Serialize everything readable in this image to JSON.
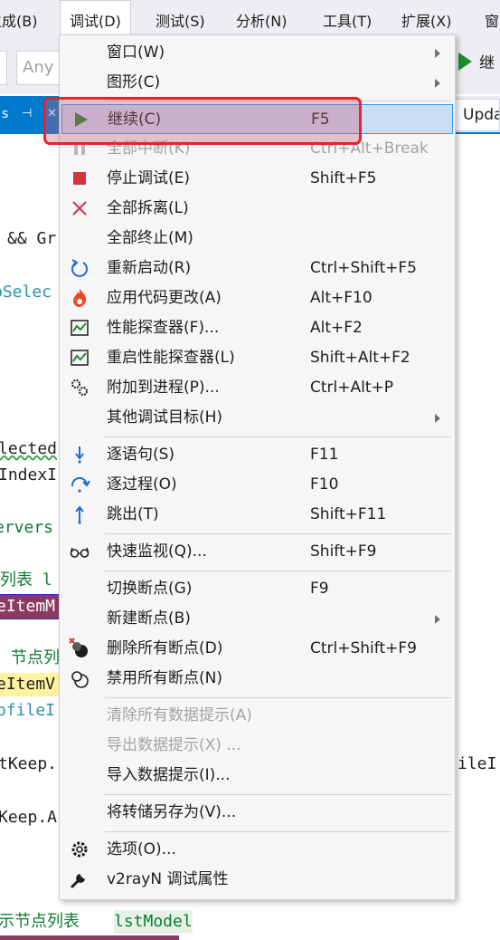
{
  "menubar": {
    "items": [
      "生成(B)",
      "调试(D)",
      "测试(S)",
      "分析(N)",
      "工具(T)",
      "扩展(X)",
      "窗"
    ]
  },
  "toolbar": {
    "config_combo": "Any",
    "continue_label": "继"
  },
  "tabs": {
    "active_tab": "s",
    "pin_glyph": "⊣",
    "close_glyph": "✕",
    "right_tab": "Upda"
  },
  "code": {
    "l1": "&& Gr",
    "l2": "bSelec",
    "l3": "lected",
    "l4": "IndexI",
    "l5": "ervers",
    "l6": "列表 l",
    "l7": "eItemM",
    "l8": "节点列",
    "l9": "eItemV",
    "l10": "ofileI",
    "l11": "tKeep.",
    "l11r": "ileI",
    "l12": "Keep.A",
    "l13a": "示节点列表 ",
    "l13b": "lstModel"
  },
  "menu": {
    "items": [
      {
        "id": "window",
        "label": "窗口(W)",
        "shortcut": "",
        "submenu": true,
        "disabled": false,
        "icon": ""
      },
      {
        "id": "graphics",
        "label": "图形(C)",
        "shortcut": "",
        "submenu": true,
        "disabled": false,
        "icon": ""
      },
      {
        "id": "continue",
        "label": "继续(C)",
        "shortcut": "F5",
        "submenu": false,
        "disabled": false,
        "icon": "play-icon"
      },
      {
        "id": "break-all",
        "label": "全部中断(K)",
        "shortcut": "Ctrl+Alt+Break",
        "submenu": false,
        "disabled": true,
        "icon": "pause-icon"
      },
      {
        "id": "stop",
        "label": "停止调试(E)",
        "shortcut": "Shift+F5",
        "submenu": false,
        "disabled": false,
        "icon": "stop-icon"
      },
      {
        "id": "detach-all",
        "label": "全部拆离(L)",
        "shortcut": "",
        "submenu": false,
        "disabled": false,
        "icon": "detach-icon"
      },
      {
        "id": "terminate-all",
        "label": "全部终止(M)",
        "shortcut": "",
        "submenu": false,
        "disabled": false,
        "icon": ""
      },
      {
        "id": "restart",
        "label": "重新启动(R)",
        "shortcut": "Ctrl+Shift+F5",
        "submenu": false,
        "disabled": false,
        "icon": "restart-icon"
      },
      {
        "id": "apply-code",
        "label": "应用代码更改(A)",
        "shortcut": "Alt+F10",
        "submenu": false,
        "disabled": false,
        "icon": "hot-reload-icon"
      },
      {
        "id": "profiler",
        "label": "性能探查器(F)...",
        "shortcut": "Alt+F2",
        "submenu": false,
        "disabled": false,
        "icon": "profiler-icon"
      },
      {
        "id": "relaunch-profiler",
        "label": "重启性能探查器(L)",
        "shortcut": "Shift+Alt+F2",
        "submenu": false,
        "disabled": false,
        "icon": "profiler-icon"
      },
      {
        "id": "attach",
        "label": "附加到进程(P)...",
        "shortcut": "Ctrl+Alt+P",
        "submenu": false,
        "disabled": false,
        "icon": "gears-icon"
      },
      {
        "id": "other-targets",
        "label": "其他调试目标(H)",
        "shortcut": "",
        "submenu": true,
        "disabled": false,
        "icon": ""
      },
      {
        "id": "step-into",
        "label": "逐语句(S)",
        "shortcut": "F11",
        "submenu": false,
        "disabled": false,
        "icon": "step-into-icon"
      },
      {
        "id": "step-over",
        "label": "逐过程(O)",
        "shortcut": "F10",
        "submenu": false,
        "disabled": false,
        "icon": "step-over-icon"
      },
      {
        "id": "step-out",
        "label": "跳出(T)",
        "shortcut": "Shift+F11",
        "submenu": false,
        "disabled": false,
        "icon": "step-out-icon"
      },
      {
        "id": "quickwatch",
        "label": "快速监视(Q)...",
        "shortcut": "Shift+F9",
        "submenu": false,
        "disabled": false,
        "icon": "glasses-icon"
      },
      {
        "id": "toggle-bp",
        "label": "切换断点(G)",
        "shortcut": "F9",
        "submenu": false,
        "disabled": false,
        "icon": ""
      },
      {
        "id": "new-bp",
        "label": "新建断点(B)",
        "shortcut": "",
        "submenu": true,
        "disabled": false,
        "icon": ""
      },
      {
        "id": "delete-bps",
        "label": "删除所有断点(D)",
        "shortcut": "Ctrl+Shift+F9",
        "submenu": false,
        "disabled": false,
        "icon": "delete-breakpoints-icon"
      },
      {
        "id": "disable-bps",
        "label": "禁用所有断点(N)",
        "shortcut": "",
        "submenu": false,
        "disabled": false,
        "icon": "disable-breakpoints-icon"
      },
      {
        "id": "clear-datatips",
        "label": "清除所有数据提示(A)",
        "shortcut": "",
        "submenu": false,
        "disabled": true,
        "icon": ""
      },
      {
        "id": "export-datatips",
        "label": "导出数据提示(X) ...",
        "shortcut": "",
        "submenu": false,
        "disabled": true,
        "icon": ""
      },
      {
        "id": "import-datatips",
        "label": "导入数据提示(I)...",
        "shortcut": "",
        "submenu": false,
        "disabled": false,
        "icon": ""
      },
      {
        "id": "save-dump",
        "label": "将转储另存为(V)...",
        "shortcut": "",
        "submenu": false,
        "disabled": false,
        "icon": ""
      },
      {
        "id": "options",
        "label": "选项(O)...",
        "shortcut": "",
        "submenu": false,
        "disabled": false,
        "icon": "gear-icon"
      },
      {
        "id": "project-props",
        "label": "v2rayN 调试属性",
        "shortcut": "",
        "submenu": false,
        "disabled": false,
        "icon": "wrench-icon"
      }
    ]
  },
  "colors": {
    "accent": "#007acc",
    "highlight_border": "#e8222e",
    "hot_item": "#c9def5",
    "play_green": "#1e8c2f",
    "stop_red": "#d1343d"
  }
}
